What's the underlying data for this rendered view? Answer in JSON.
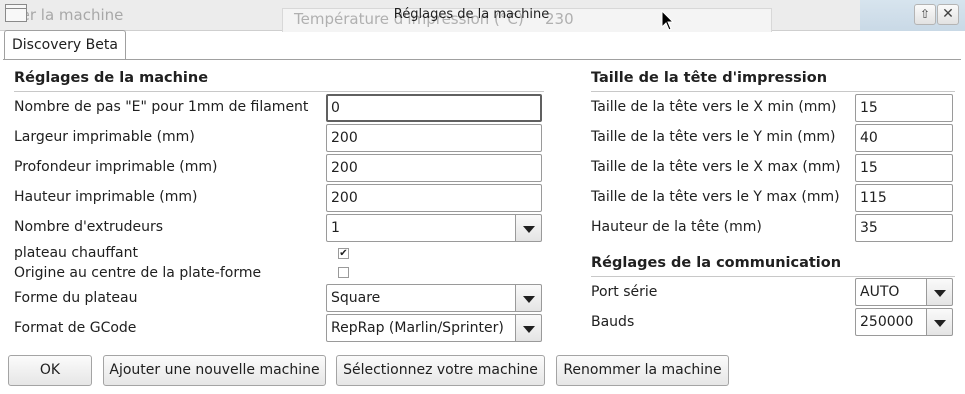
{
  "window": {
    "title": "Réglages de la machine",
    "background_left_text": "mer la machine",
    "background_field_text": "Température d'impression (°C)",
    "background_field_value": "230"
  },
  "tab": {
    "label": "Discovery Beta"
  },
  "machine": {
    "title": "Réglages de la machine",
    "steps_label": "Nombre de pas \"E\" pour 1mm de filament",
    "steps_value": "0",
    "width_label": "Largeur imprimable (mm)",
    "width_value": "200",
    "depth_label": "Profondeur imprimable (mm)",
    "depth_value": "200",
    "height_label": "Hauteur imprimable (mm)",
    "height_value": "200",
    "extruders_label": "Nombre d'extrudeurs",
    "extruders_value": "1",
    "heated_bed_label": "plateau chauffant",
    "heated_bed_checked": true,
    "center_origin_label": "Origine au centre de la plate-forme",
    "center_origin_checked": false,
    "bed_shape_label": "Forme du plateau",
    "bed_shape_value": "Square",
    "gcode_label": "Format de GCode",
    "gcode_value": "RepRap (Marlin/Sprinter)"
  },
  "head": {
    "title": "Taille de la tête d'impression",
    "xmin_label": "Taille de la tête vers le X min (mm)",
    "xmin_value": "15",
    "ymin_label": "Taille de la tête vers le Y min (mm)",
    "ymin_value": "40",
    "xmax_label": "Taille de la tête vers le X max (mm)",
    "xmax_value": "15",
    "ymax_label": "Taille de la tête vers le Y max (mm)",
    "ymax_value": "115",
    "headh_label": "Hauteur de la tête (mm)",
    "headh_value": "35"
  },
  "comm": {
    "title": "Réglages de la communication",
    "port_label": "Port série",
    "port_value": "AUTO",
    "baud_label": "Bauds",
    "baud_value": "250000"
  },
  "buttons": {
    "ok": "OK",
    "add": "Ajouter une nouvelle machine",
    "select": "Sélectionnez votre machine",
    "rename": "Renommer la machine"
  },
  "icons": {
    "window": "window-icon",
    "maximize": "up-arrow-icon",
    "close": "close-icon",
    "checkbox_checked": "check-icon"
  },
  "colors": {
    "title_bar": "#ececec",
    "border": "#9a9a9a"
  }
}
